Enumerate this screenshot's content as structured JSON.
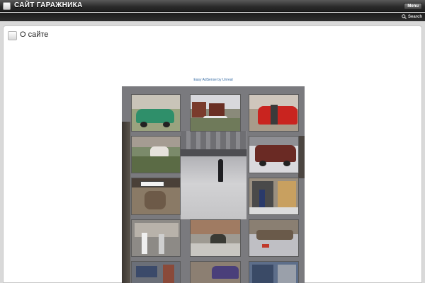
{
  "header": {
    "site_title": "САЙТ ГАРАЖНИКА",
    "menu_label": "Menu"
  },
  "search": {
    "label": "Search"
  },
  "page": {
    "title": "О сайте",
    "adsense_link": "Easy AdSense by Unreal"
  },
  "collage": {
    "photos": [
      {
        "subject": "green-vintage-car"
      },
      {
        "subject": "garages-with-goats"
      },
      {
        "subject": "red-car-open-doors"
      },
      {
        "subject": "goats-by-garage"
      },
      {
        "subject": "dark-red-suv"
      },
      {
        "subject": "man-with-license-plate"
      },
      {
        "subject": "man-in-garage-doorway"
      },
      {
        "subject": "workshop-interior"
      },
      {
        "subject": "men-working-on-ground"
      },
      {
        "subject": "man-under-car"
      },
      {
        "subject": "workers-at-garage"
      },
      {
        "subject": "blue-car"
      },
      {
        "subject": "garage-doors"
      }
    ]
  },
  "colors": {
    "header_bg": "#2a2a2a",
    "page_bg": "#d9d9d9",
    "content_bg": "#ffffff",
    "link": "#3a6ea5"
  }
}
